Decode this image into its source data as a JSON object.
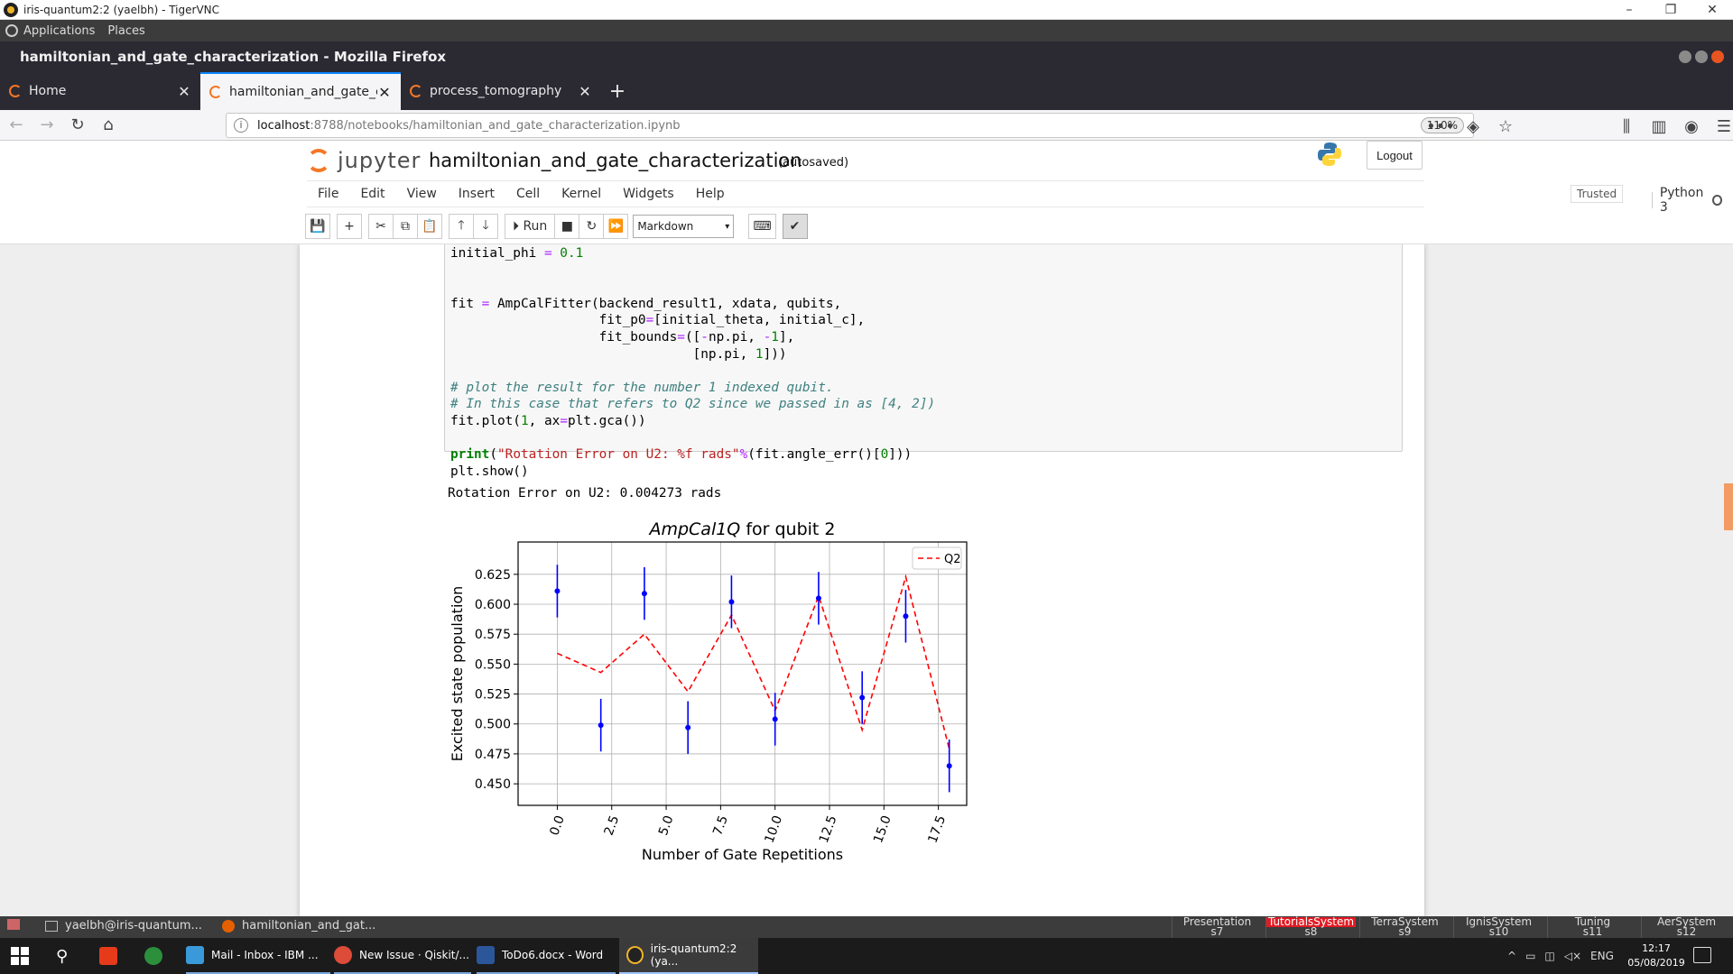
{
  "vnc": {
    "title": "iris-quantum2:2 (yaelbh) - TigerVNC",
    "min": "–",
    "restore": "❐",
    "close": "✕"
  },
  "gnome_top": {
    "applications": "Applications",
    "places": "Places"
  },
  "firefox": {
    "window_title": "hamiltonian_and_gate_characterization - Mozilla Firefox",
    "tabs": [
      {
        "label": "Home",
        "close": "✕"
      },
      {
        "label": "hamiltonian_and_gate_characterization",
        "close": "✕"
      },
      {
        "label": "process_tomography",
        "close": "✕"
      }
    ],
    "new_tab": "+",
    "url_host": "localhost",
    "url_path": ":8788/notebooks/hamiltonian_and_gate_characterization.ipynb",
    "zoom": "110%",
    "icons": {
      "back": "←",
      "forward": "→",
      "reload": "↻",
      "home": "⌂",
      "more": "•••",
      "pocket": "◈",
      "star": "☆",
      "library": "⫼",
      "sidebar": "▥",
      "account": "◉",
      "menu": "☰"
    }
  },
  "jupyter": {
    "logo_text": "jupyter",
    "notebook_title": "hamiltonian_and_gate_characterization",
    "autosave": "(autosaved)",
    "logout": "Logout",
    "menu": [
      "File",
      "Edit",
      "View",
      "Insert",
      "Cell",
      "Kernel",
      "Widgets",
      "Help"
    ],
    "trusted": "Trusted",
    "kernel": "Python 3",
    "toolbar": {
      "save": "💾",
      "add": "+",
      "cut": "✂",
      "copy": "⧉",
      "paste": "📋",
      "up": "🡑",
      "down": "🡓",
      "run": "Run",
      "stop": "■",
      "restart": "↻",
      "fast_forward": "⏩",
      "cell_type": "Markdown",
      "keyboard": "⌨",
      "check": "✔"
    }
  },
  "code": {
    "l1a": "initial_phi ",
    "l1op": "=",
    "l1num": " 0.1",
    "l2a": "fit ",
    "l2op": "=",
    "l2b": " AmpCalFitter(backend_result1, xdata, qubits,",
    "l3a": "                   fit_p0",
    "l3op": "=",
    "l3b": "[initial_theta, initial_c],",
    "l4a": "                   fit_bounds",
    "l4op": "=",
    "l4b": "([",
    "l4op2": "-",
    "l4c": "np.pi, ",
    "l4op3": "-",
    "l4num": "1",
    "l4d": "],",
    "l5a": "                               [np.pi, ",
    "l5num": "1",
    "l5b": "]))",
    "l6": "# plot the result for the number 1 indexed qubit.",
    "l7": "# In this case that refers to Q2 since we passed in as [4, 2])",
    "l8a": "fit.plot(",
    "l8num": "1",
    "l8b": ", ax",
    "l8op": "=",
    "l8c": "plt.gca())",
    "l9a": "print",
    "l9b": "(",
    "l9str": "\"Rotation Error on U2: %f rads\"",
    "l9op": "%",
    "l9c": "(fit.angle_err()[",
    "l9num": "0",
    "l9d": "]))",
    "l10": "plt.show()"
  },
  "output": "Rotation Error on U2: 0.004273 rads",
  "chart_data": {
    "type": "scatter",
    "title_italic": "AmpCal1Q",
    "title_rest": " for qubit 2",
    "xlabel": "Number of Gate Repetitions",
    "ylabel": "Excited state population",
    "xlim": [
      -1.8,
      18.8
    ],
    "ylim": [
      0.432,
      0.652
    ],
    "xticks": [
      "0.0",
      "2.5",
      "5.0",
      "7.5",
      "10.0",
      "12.5",
      "15.0",
      "17.5"
    ],
    "yticks": [
      "0.625",
      "0.600",
      "0.575",
      "0.550",
      "0.525",
      "0.500",
      "0.475",
      "0.450"
    ],
    "grid": true,
    "legend": {
      "placement": "top-right",
      "label": "Q2"
    },
    "points": {
      "x": [
        0,
        2,
        4,
        6,
        8,
        10,
        12,
        14,
        16,
        18
      ],
      "y": [
        0.611,
        0.499,
        0.609,
        0.497,
        0.602,
        0.504,
        0.605,
        0.522,
        0.59,
        0.465
      ],
      "err": [
        0.022,
        0.022,
        0.022,
        0.022,
        0.022,
        0.022,
        0.022,
        0.022,
        0.022,
        0.022
      ],
      "color": "#0000ff"
    },
    "fit": {
      "name": "Q2",
      "x": [
        0,
        2,
        4,
        6,
        8,
        10,
        12,
        14,
        16,
        18
      ],
      "y": [
        0.559,
        0.543,
        0.575,
        0.527,
        0.591,
        0.511,
        0.607,
        0.495,
        0.623,
        0.479
      ],
      "color": "#ff0000"
    }
  },
  "gnome_bottom": {
    "windows": [
      "yaelbh@iris-quantum...",
      "hamiltonian_and_gat..."
    ],
    "workspaces": [
      {
        "name": "Presentation",
        "num": "s7"
      },
      {
        "name": "TutorialsSystem",
        "num": "s8"
      },
      {
        "name": "TerraSystem",
        "num": "s9"
      },
      {
        "name": "IgnisSystem",
        "num": "s10"
      },
      {
        "name": "Tuning",
        "num": "s11"
      },
      {
        "name": "AerSystem",
        "num": "s12"
      }
    ]
  },
  "taskbar": {
    "items": [
      "Mail - Inbox - IBM ...",
      "New Issue · Qiskit/...",
      "ToDo6.docx - Word",
      "iris-quantum2:2 (ya..."
    ],
    "search_icon": "⚲",
    "tray": {
      "chevron": "^",
      "lang": "ENG"
    },
    "time": "12:17",
    "date": "05/08/2019"
  }
}
